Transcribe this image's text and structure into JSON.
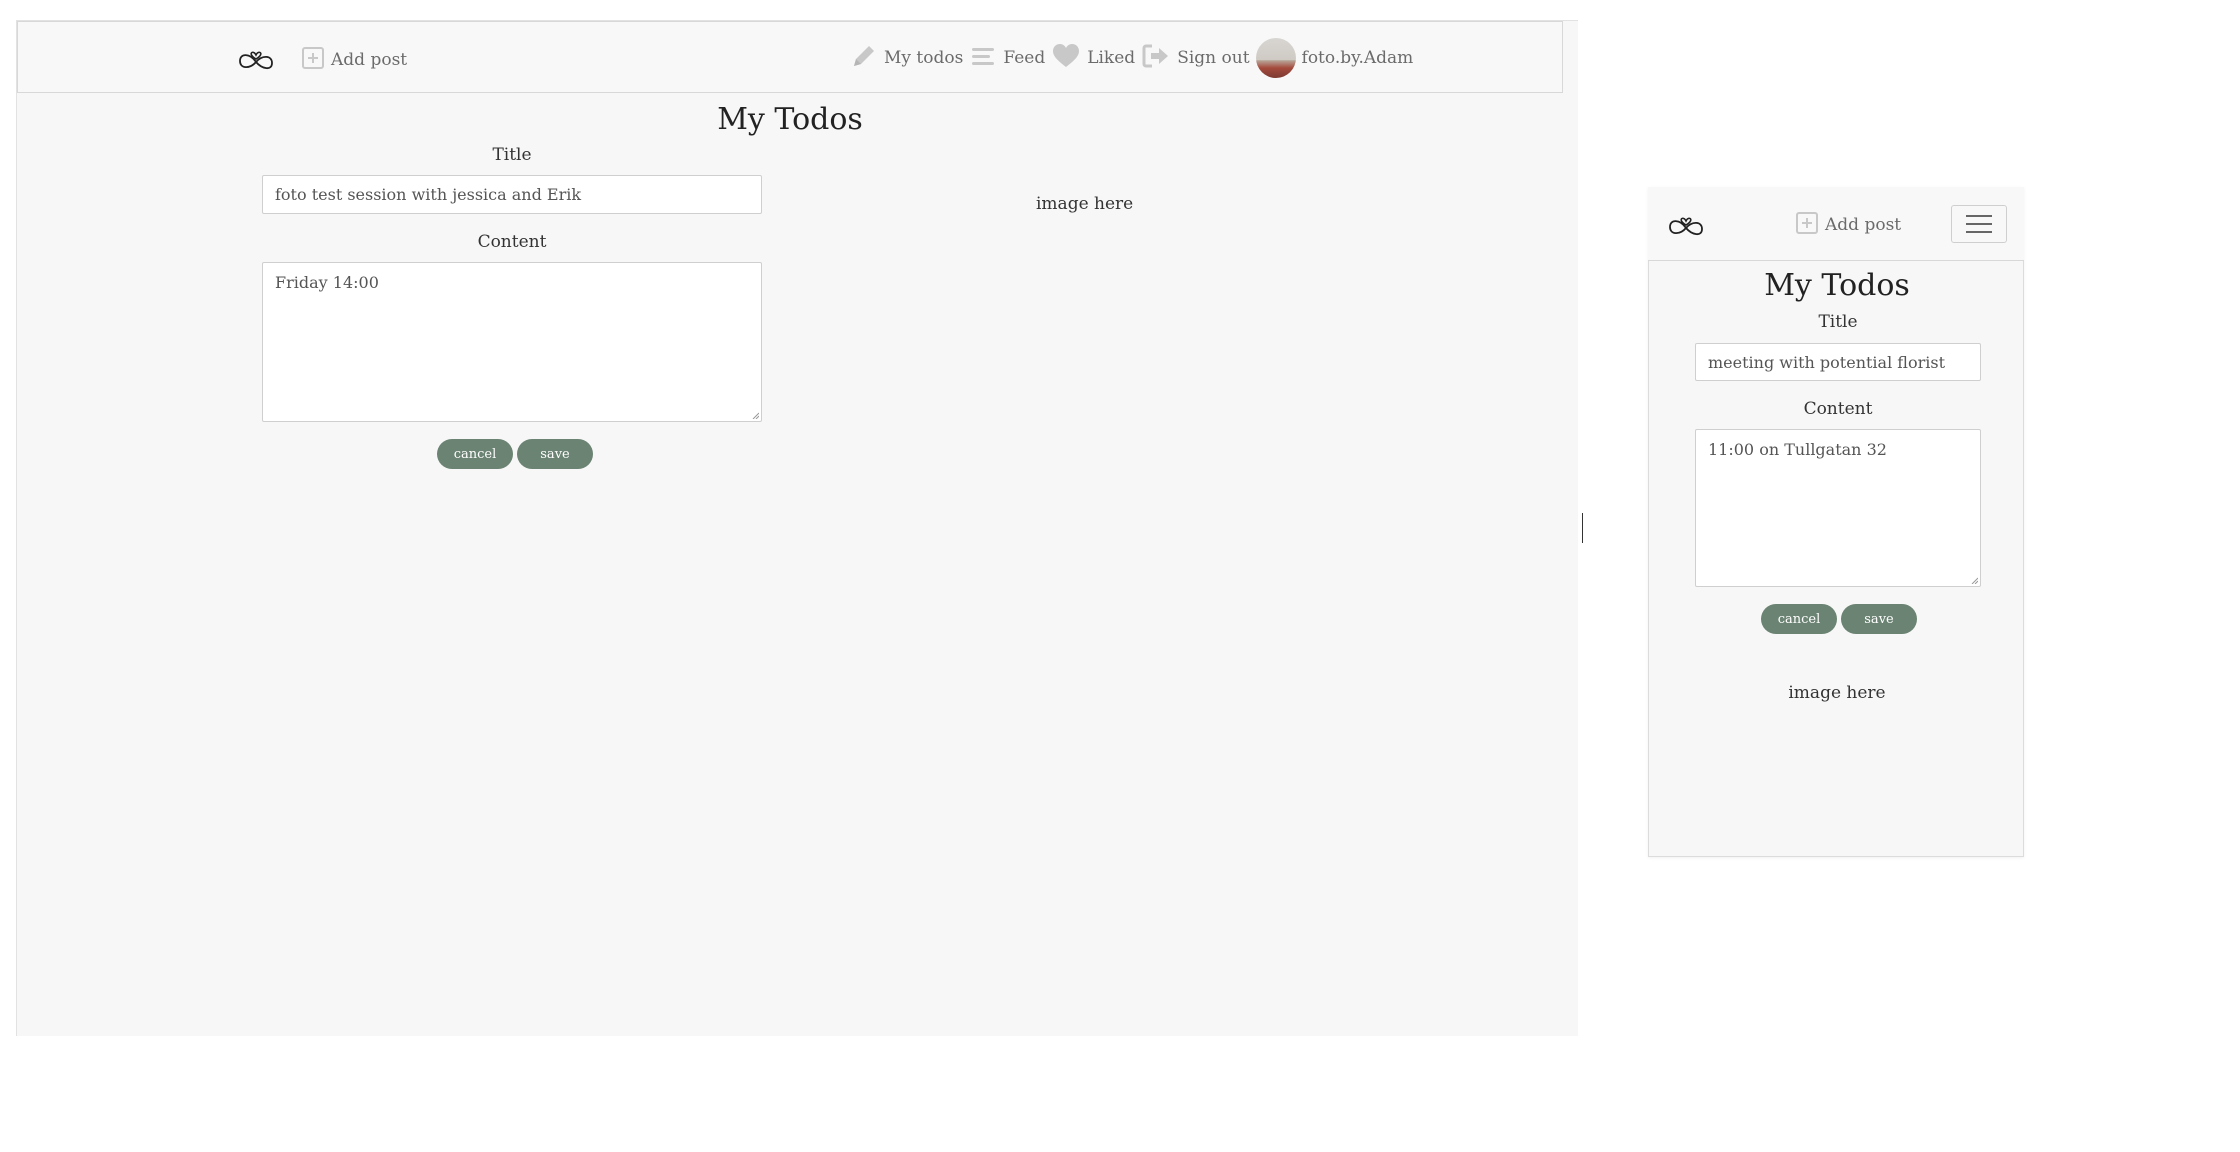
{
  "desktop": {
    "nav": {
      "add_post": "Add post",
      "my_todos": "My todos",
      "feed": "Feed",
      "liked": "Liked",
      "sign_out": "Sign out",
      "username": "foto.by.Adam"
    },
    "page_title": "My Todos",
    "form": {
      "title_label": "Title",
      "title_value": "foto test session with jessica and Erik",
      "content_label": "Content",
      "content_value": "Friday 14:00",
      "cancel_label": "cancel",
      "save_label": "save"
    },
    "image_placeholder": "image here"
  },
  "mobile": {
    "nav": {
      "add_post": "Add post"
    },
    "page_title": "My Todos",
    "form": {
      "title_label": "Title",
      "title_value": "meeting with potential florist",
      "content_label": "Content",
      "content_value": "11:00 on Tullgatan 32",
      "cancel_label": "cancel",
      "save_label": "save"
    },
    "image_placeholder": "image here"
  },
  "icons": {
    "logo": "infinity-heart-logo-icon",
    "add_post": "plus-square-icon",
    "my_todos": "pencil-icon",
    "feed": "menu-lines-icon",
    "liked": "heart-icon",
    "sign_out": "sign-out-icon",
    "menu": "hamburger-icon"
  },
  "colors": {
    "accent": "#6b8372",
    "background": "#f7f7f7",
    "nav_text": "#6b6b6b",
    "icon": "#c8c8c8"
  }
}
